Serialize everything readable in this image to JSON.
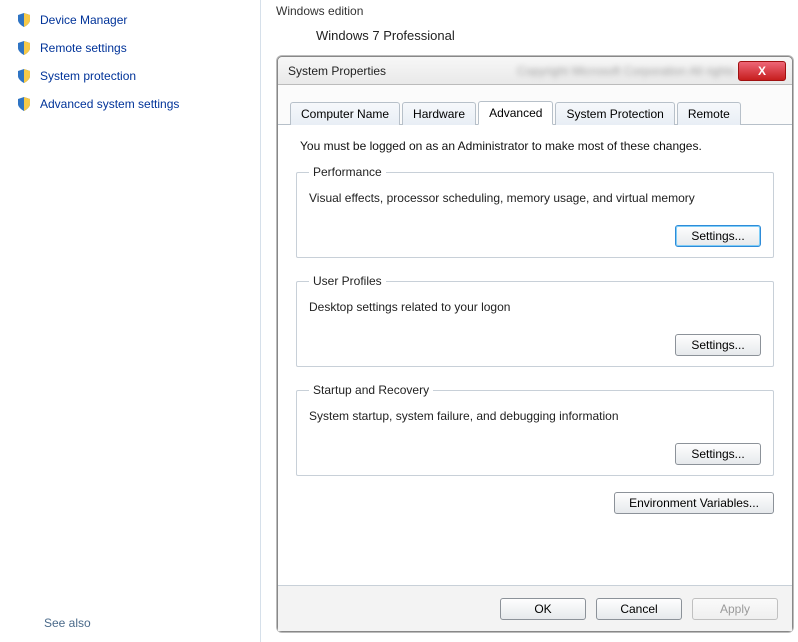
{
  "sidebar": {
    "items": [
      {
        "label": "Device Manager"
      },
      {
        "label": "Remote settings"
      },
      {
        "label": "System protection"
      },
      {
        "label": "Advanced system settings"
      }
    ],
    "see_also": "See also"
  },
  "background": {
    "section_title": "Windows edition",
    "os_name": "Windows 7 Professional"
  },
  "dialog": {
    "title": "System Properties",
    "tabs": [
      {
        "label": "Computer Name"
      },
      {
        "label": "Hardware"
      },
      {
        "label": "Advanced"
      },
      {
        "label": "System Protection"
      },
      {
        "label": "Remote"
      }
    ],
    "intro": "You must be logged on as an Administrator to make most of these changes.",
    "groups": {
      "performance": {
        "legend": "Performance",
        "desc": "Visual effects, processor scheduling, memory usage, and virtual memory",
        "button": "Settings..."
      },
      "user_profiles": {
        "legend": "User Profiles",
        "desc": "Desktop settings related to your logon",
        "button": "Settings..."
      },
      "startup": {
        "legend": "Startup and Recovery",
        "desc": "System startup, system failure, and debugging information",
        "button": "Settings..."
      }
    },
    "env_button": "Environment Variables...",
    "footer": {
      "ok": "OK",
      "cancel": "Cancel",
      "apply": "Apply"
    },
    "close_glyph": "X"
  }
}
